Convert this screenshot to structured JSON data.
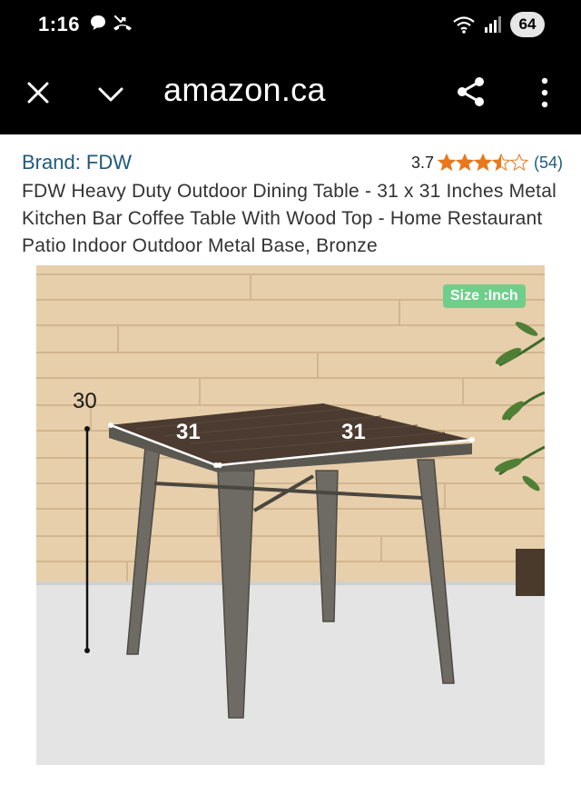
{
  "status_bar": {
    "time": "1:16",
    "battery": "64",
    "icons": [
      "chat-icon",
      "missed-call-icon",
      "wifi-icon",
      "signal-icon"
    ]
  },
  "nav": {
    "domain": "amazon.ca",
    "icons": [
      "close-icon",
      "chevron-down-icon",
      "share-icon",
      "more-vertical-icon"
    ]
  },
  "product": {
    "brand": "Brand: FDW",
    "rating": "3.7",
    "stars": 3.7,
    "review_count": "(54)",
    "title": "FDW Heavy Duty Outdoor Dining Table - 31 x 31 Inches Metal Kitchen Bar Coffee Table With Wood Top - Home Restaurant Patio Indoor Outdoor Metal Base, Bronze"
  },
  "image": {
    "badge": "Size :Inch",
    "dim_height": "30",
    "dim_width_left": "31",
    "dim_width_right": "31"
  },
  "colors": {
    "link": "#1e5a7e",
    "star": "#e8781b",
    "badge": "#6fcf8a"
  }
}
